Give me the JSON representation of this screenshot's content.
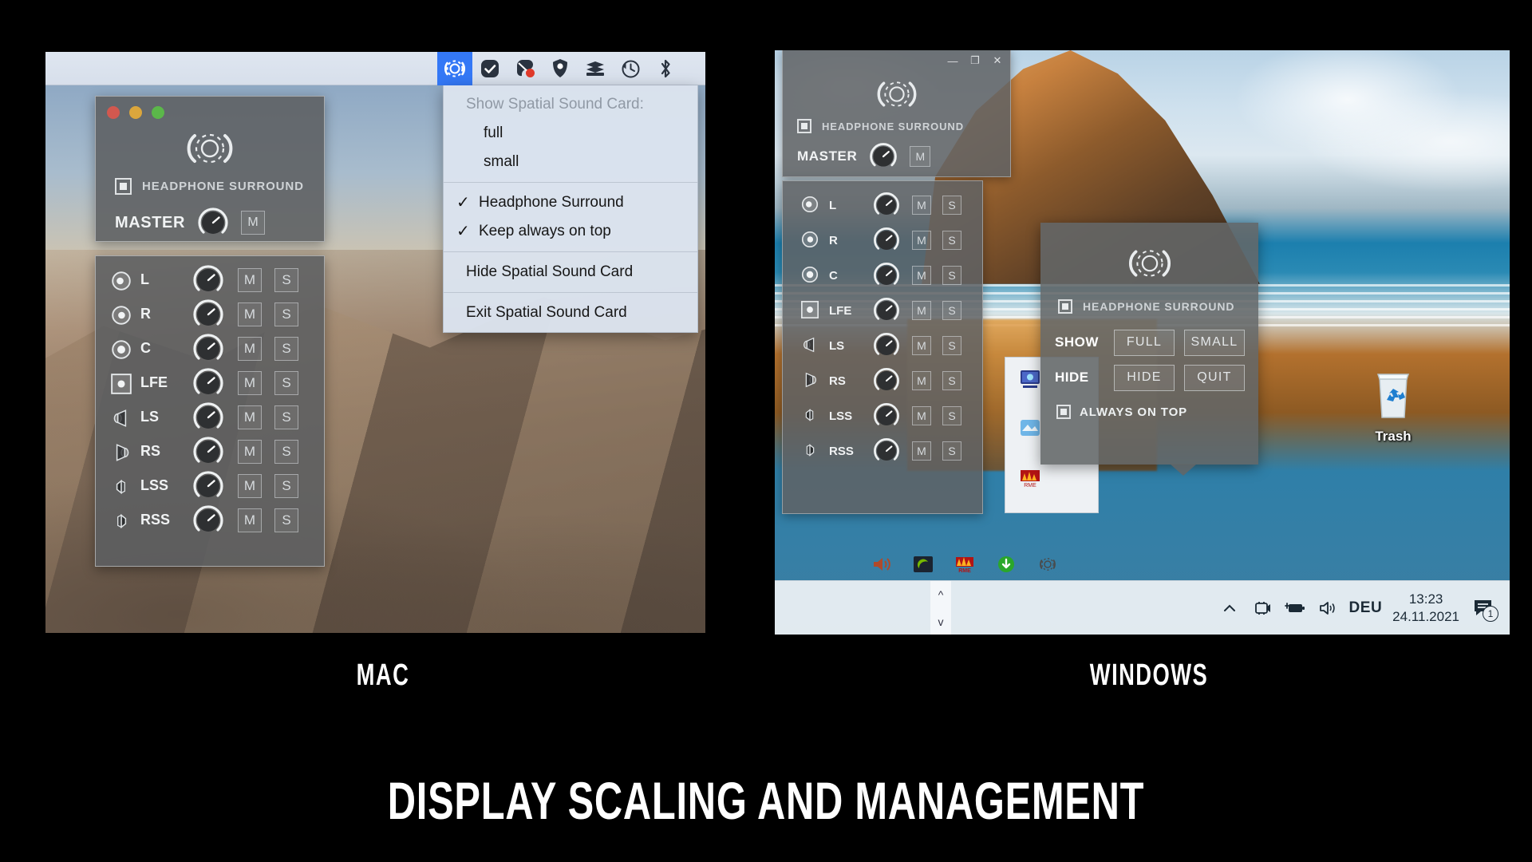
{
  "page": {
    "title": "DISPLAY SCALING AND MANAGEMENT",
    "caption_left": "MAC",
    "caption_right": "WINDOWS",
    "background": "#000000"
  },
  "mac": {
    "menubar": {
      "icons": [
        {
          "name": "spatial-sound-card-icon",
          "active": true
        },
        {
          "name": "check-badge-icon",
          "active": false
        },
        {
          "name": "record-camera-icon",
          "active": false
        },
        {
          "name": "shield-location-icon",
          "active": false
        },
        {
          "name": "layers-icon",
          "active": false
        },
        {
          "name": "time-machine-icon",
          "active": false
        },
        {
          "name": "bluetooth-icon",
          "active": false
        }
      ]
    },
    "menu": {
      "header": "Show Spatial Sound Card:",
      "show_options": [
        "full",
        "small"
      ],
      "toggles": [
        {
          "label": "Headphone Surround",
          "checked": true,
          "tick": "✓"
        },
        {
          "label": "Keep always on top",
          "checked": true,
          "tick": "✓"
        }
      ],
      "actions": [
        "Hide Spatial Sound Card",
        "Exit Spatial Sound Card"
      ]
    },
    "master_window": {
      "traffic_lights": [
        "close",
        "minimize",
        "zoom"
      ],
      "headphone_label": "HEADPHONE SURROUND",
      "master_label": "MASTER",
      "mute_label": "M"
    },
    "channels_window": {
      "mute_label": "M",
      "solo_label": "S",
      "channels": [
        {
          "name": "L",
          "icon": "speaker-front-left-icon",
          "boxed": false
        },
        {
          "name": "R",
          "icon": "speaker-front-right-icon",
          "boxed": false
        },
        {
          "name": "C",
          "icon": "speaker-center-icon",
          "boxed": false
        },
        {
          "name": "LFE",
          "icon": "subwoofer-icon",
          "boxed": true
        },
        {
          "name": "LS",
          "icon": "speaker-left-surround-icon",
          "boxed": false
        },
        {
          "name": "RS",
          "icon": "speaker-right-surround-icon",
          "boxed": false
        },
        {
          "name": "LSS",
          "icon": "speaker-left-side-icon",
          "boxed": false
        },
        {
          "name": "RSS",
          "icon": "speaker-right-side-icon",
          "boxed": false
        }
      ]
    }
  },
  "windows": {
    "master_window": {
      "window_buttons": {
        "minimize": "—",
        "maximize": "❐",
        "close": "✕"
      },
      "headphone_label": "HEADPHONE SURROUND",
      "master_label": "MASTER",
      "mute_label": "M"
    },
    "channels_window": {
      "mute_label": "M",
      "solo_label": "S",
      "channels": [
        {
          "name": "L",
          "icon": "speaker-front-left-icon",
          "boxed": false
        },
        {
          "name": "R",
          "icon": "speaker-front-right-icon",
          "boxed": false
        },
        {
          "name": "C",
          "icon": "speaker-center-icon",
          "boxed": false
        },
        {
          "name": "LFE",
          "icon": "subwoofer-icon",
          "boxed": true
        },
        {
          "name": "LS",
          "icon": "speaker-left-surround-icon",
          "boxed": false
        },
        {
          "name": "RS",
          "icon": "speaker-right-surround-icon",
          "boxed": false
        },
        {
          "name": "LSS",
          "icon": "speaker-left-side-icon",
          "boxed": false
        },
        {
          "name": "RSS",
          "icon": "speaker-right-side-icon",
          "boxed": false
        }
      ]
    },
    "tray_popup": {
      "headphone_label": "HEADPHONE SURROUND",
      "rows": [
        {
          "label": "SHOW",
          "buttons": [
            "FULL",
            "SMALL"
          ]
        },
        {
          "label": "HIDE",
          "buttons": [
            "HIDE",
            "QUIT"
          ]
        }
      ],
      "always_on_top_label": "ALWAYS ON TOP"
    },
    "desktop": {
      "trash_label": "Trash"
    },
    "taskbar": {
      "tray_icons": [
        "volume-icon",
        "nvidia-icon",
        "rme-icon",
        "green-update-icon",
        "spatial-sound-card-icon"
      ],
      "status_icons": [
        "chevron-up-icon",
        "screencast-icon",
        "battery-icon",
        "speaker-icon"
      ],
      "language": "DEU",
      "time": "13:23",
      "date": "24.11.2021",
      "notification_count": "1",
      "scroll_up": "^",
      "scroll_down": "v"
    }
  },
  "colors": {
    "accent_blue": "#3478f6",
    "panel_gray": "#5c5f61",
    "text_light": "#e3e6e8",
    "traffic_red": "#d2584f",
    "traffic_yellow": "#dba63c",
    "traffic_green": "#5bb74a"
  }
}
